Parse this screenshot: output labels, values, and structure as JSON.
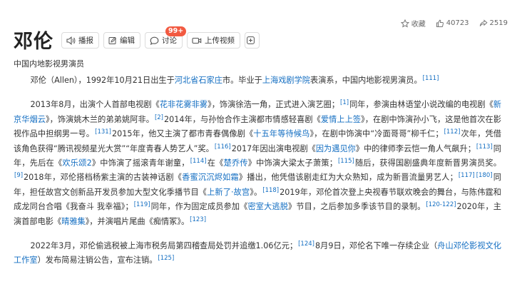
{
  "title": "邓伦",
  "subtitle": "中国内地影视男演员",
  "toolbar": {
    "broadcast": "播报",
    "edit": "编辑",
    "discuss": "讨论",
    "discuss_badge": "99+",
    "upload_video": "上传视频",
    "plus": "+"
  },
  "actions": {
    "collect": "收藏",
    "likes": "40723",
    "shares": "2519"
  },
  "p1": {
    "s1": "邓伦（Allen），1992年10月21日出生于",
    "l1": "河北省石家庄",
    "s2": "市。毕业于",
    "l2": "上海戏剧学院",
    "s3": "表演系，中国内地影视男演员。",
    "r1": "[111]"
  },
  "p2": {
    "s1": "2013年8月，出演个人首部电视剧《",
    "l1": "花非花雾非雾",
    "s2": "》，饰演徐浩一角，正式进入演艺圈；",
    "r1": "[1]",
    "s3": "同年，参演由林语堂小说改编的电视剧《",
    "l2": "新京华烟云",
    "s4": "》，饰演姚木兰的弟弟姚阿非。",
    "r2": "[2]",
    "s5": "2014年，与孙怡合作主演都市情感轻喜剧《",
    "l3": "爱情上上签",
    "s6": "》，在剧中饰演孙小飞，这是他首次在影视作品中担纲男一号。",
    "r3": "[131]",
    "s7": "2015年，他又主演了都市青春偶像剧《",
    "l4": "十五年等待候鸟",
    "s8": "》，在剧中饰演中“冷面哥哥”柳千仁；",
    "r4": "[112]",
    "s9": "次年，凭借该角色获得“腾讯视频星光大赏”“年度青春人势艺人”奖。",
    "r5": "[116]",
    "s10": "2017年因出演电视剧《",
    "l5": "因为遇见你",
    "s11": "》中的律师李云恺一角人气飙升；",
    "r6": "[113]",
    "s12": "同年，先后在《",
    "l6": "欢乐颂2",
    "s13": "》中饰演了摇滚青年谢童，",
    "r7": "[114]",
    "s14": "在《",
    "l7": "楚乔传",
    "s15": "》中饰演大梁太子萧策；",
    "r8": "[115]",
    "s16": "随后，获得国剧盛典年度新晋男演员奖。",
    "r9": "[9]",
    "s17": "2018年，邓伦搭档杨紫主演的古装神话剧《",
    "l8": "香蜜沉沉烬如霜",
    "s18": "》播出，他凭借该剧走红为大众熟知，成为新晋流量男艺人；",
    "r10": "[117]",
    "r11": "[180]",
    "s19": "同年，担任故宫文创新品开发员参加大型文化季播节目《",
    "l9": "上新了·故宫",
    "s20": "》。",
    "r12": "[118]",
    "s21": "2019年，邓伦首次登上央视春节联欢晚会的舞台，与陈伟霆和成龙同台合唱《我奋斗 我幸福》；",
    "r13": "[119]",
    "s22": "同年，作为固定成员参加《",
    "l10": "密室大逃脱",
    "s23": "》节目，之后参加多季该节目的录制。",
    "r14": "[120-122]",
    "s24": "2020年，主演首部电影《",
    "l11": "晴雅集",
    "s25": "》，并演唱片尾曲《痴情冢》。",
    "r15": "[123]"
  },
  "p3": {
    "s1": "2022年3月，邓伦偷逃税被上海市税务局第四稽查局处罚并追缴1.06亿元；",
    "r1": "[124]",
    "s2": "8月9日，邓伦名下唯一存续企业（",
    "l1": "舟山邓伦影视文化工作室",
    "s3": "）发布简易注销公告，宣布注销。",
    "r2": "[125]"
  },
  "colors": {
    "link": "#136ec2",
    "badge": "#f25a41",
    "text": "#333333"
  },
  "icons": [
    "speaker-icon",
    "pencil-icon",
    "chat-icon",
    "video-icon",
    "star-icon",
    "thumbs-up-icon",
    "share-icon"
  ]
}
